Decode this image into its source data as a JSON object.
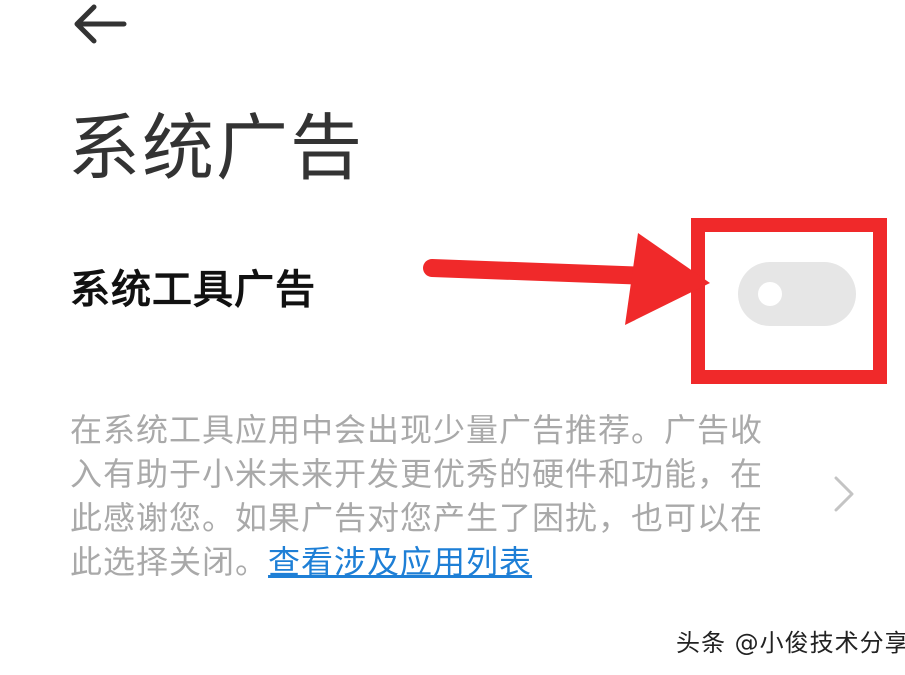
{
  "header": {
    "back_icon": "arrow-left-icon",
    "title": "系统广告"
  },
  "setting": {
    "title": "系统工具广告",
    "toggle_state": "off",
    "description": "在系统工具应用中会出现少量广告推荐。广告收入有助于小米未来开发更优秀的硬件和功能，在此感谢您。如果广告对您产生了困扰，也可以在此选择关闭。",
    "link_text": "查看涉及应用列表",
    "chevron_icon": "chevron-right-icon"
  },
  "annotation": {
    "arrow_color": "#f0292a",
    "box_color": "#f0292a"
  },
  "watermark": {
    "text": "头条 @小俊技术分享"
  }
}
